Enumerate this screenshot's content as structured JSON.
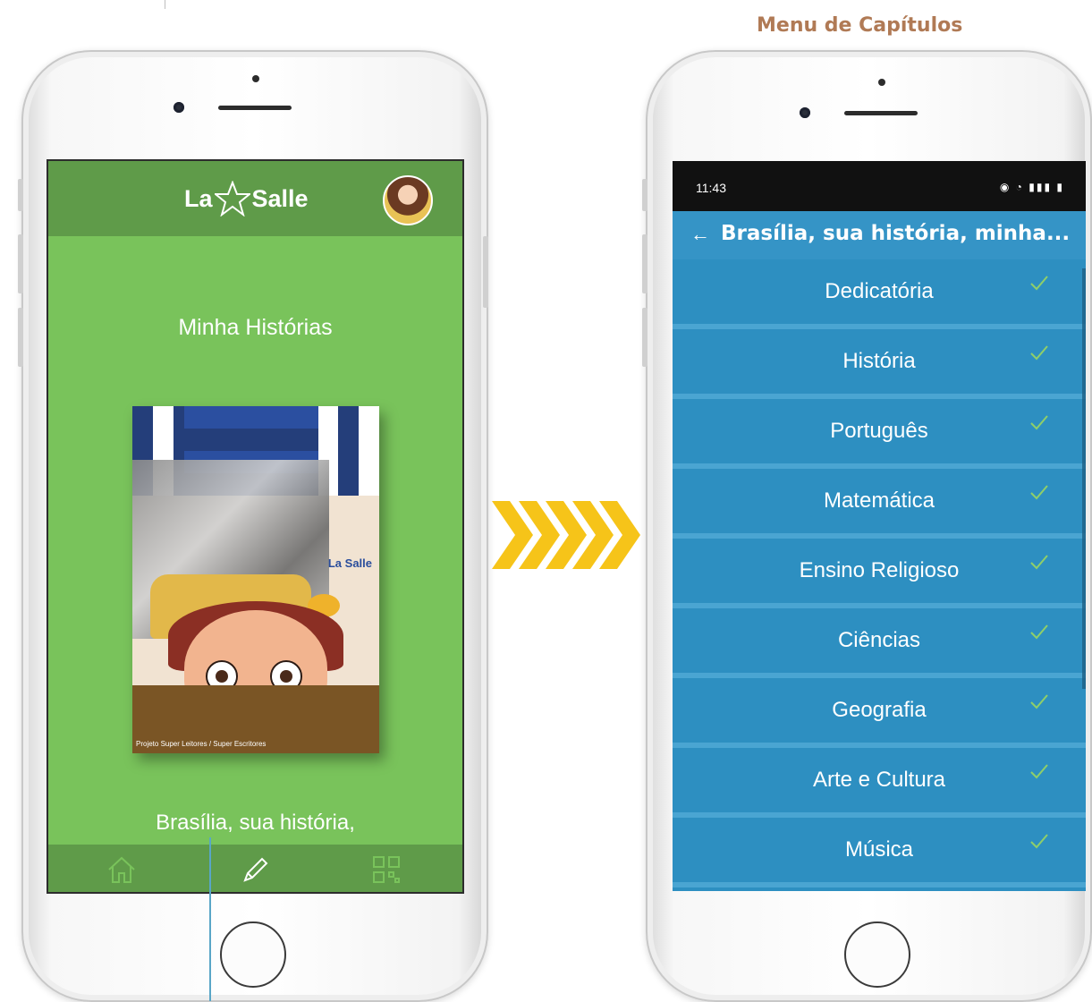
{
  "heading": "Menu de Capítulos",
  "left_screen": {
    "logo_text_left": "La",
    "logo_text_right": "Salle",
    "title": "Minha Histórias",
    "book": {
      "brand": "La Salle",
      "caption": "Projeto Super Leitores / Super Escritores"
    },
    "story_title": "Brasília, sua história,"
  },
  "right_screen": {
    "status_time": "11:43",
    "status_icons": "◉ ◔ ▮▮▮ ▮",
    "toolbar_back": "←",
    "toolbar_title": "Brasília, sua história, minha...",
    "chapters": [
      {
        "label": "Dedicatória"
      },
      {
        "label": "História"
      },
      {
        "label": "Português"
      },
      {
        "label": "Matemática"
      },
      {
        "label": "Ensino Religioso"
      },
      {
        "label": "Ciências"
      },
      {
        "label": "Geografia"
      },
      {
        "label": "Arte e Cultura"
      },
      {
        "label": "Música"
      }
    ]
  },
  "colors": {
    "green_bg": "#79c35b",
    "green_header": "#5f9b49",
    "blue_list": "#2d8fc1",
    "chevron": "#f6c419",
    "check": "#8fcf6a"
  }
}
